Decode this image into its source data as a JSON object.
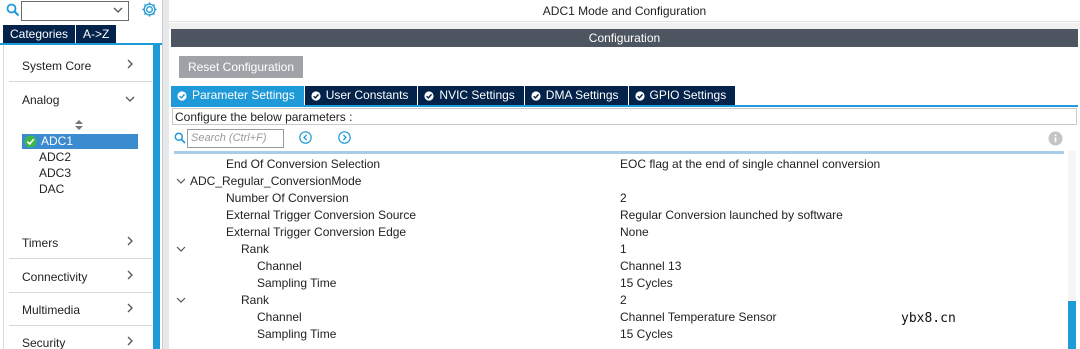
{
  "left_panel": {
    "tabs": {
      "categories": "Categories",
      "atoz": "A->Z"
    },
    "categories": {
      "system_core": "System Core",
      "analog": "Analog",
      "timers": "Timers",
      "connectivity": "Connectivity",
      "multimedia": "Multimedia",
      "security": "Security"
    },
    "analog_items": [
      "ADC1",
      "ADC2",
      "ADC3",
      "DAC"
    ]
  },
  "main": {
    "mode_title": "ADC1 Mode and Configuration",
    "config_title": "Configuration",
    "reset_button": "Reset Configuration",
    "tabs": [
      "Parameter Settings",
      "User Constants",
      "NVIC Settings",
      "DMA Settings",
      "GPIO Settings"
    ],
    "configure_label": "Configure the below parameters :",
    "search_placeholder": "Search (Ctrl+F)",
    "rows": [
      {
        "name": "End Of Conversion Selection",
        "value": "EOC flag at the end of single channel conversion"
      },
      {
        "name": "ADC_Regular_ConversionMode",
        "value": ""
      },
      {
        "name": "Number Of Conversion",
        "value": "2"
      },
      {
        "name": "External Trigger Conversion Source",
        "value": "Regular Conversion launched by software"
      },
      {
        "name": "External Trigger Conversion Edge",
        "value": "None"
      },
      {
        "name": "Rank",
        "value": "1"
      },
      {
        "name": "Channel",
        "value": "Channel 13"
      },
      {
        "name": "Sampling Time",
        "value": "15 Cycles"
      },
      {
        "name": "Rank",
        "value": "2"
      },
      {
        "name": "Channel",
        "value": "Channel Temperature Sensor"
      },
      {
        "name": "Sampling Time",
        "value": "15 Cycles"
      }
    ]
  },
  "watermark": "ybx8.cn",
  "colors": {
    "dark_navy": "#03234b",
    "accent_blue": "#1f9ad8",
    "config_bar": "#4d5560",
    "reset_button": "#9fa3a8",
    "selected_item": "#3b8bd0",
    "check_green": "#3db64a"
  }
}
